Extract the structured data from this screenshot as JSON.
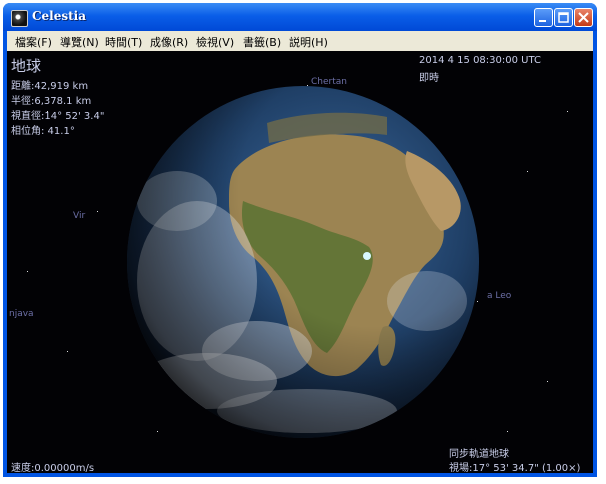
{
  "window": {
    "title": "Celestia"
  },
  "menu": [
    "檔案(F)",
    "導覽(N)",
    "時間(T)",
    "成像(R)",
    "檢視(V)",
    "書籤(B)",
    "説明(H)"
  ],
  "hud": {
    "object_name": "地球",
    "distance": "距離:42,919 km",
    "radius": "半徑:6,378.1 km",
    "apparent_diameter": "視直徑:14° 52' 3.4\"",
    "phase_angle": "相位角: 41.1°",
    "datetime": "2014 4 15 08:30:00 UTC",
    "time_mode": "即時",
    "speed": "速度:0.00000m/s",
    "tracking": "同步軌道地球",
    "fov": "視場:17° 53' 34.7\" (1.00×)"
  },
  "star_labels": {
    "chertan": "Chertan",
    "vir": "Vir",
    "leo": "a Leo",
    "njava": "njava"
  }
}
